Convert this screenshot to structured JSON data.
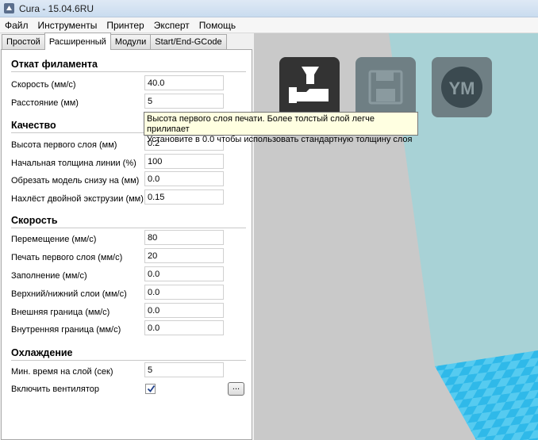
{
  "window": {
    "title": "Cura - 15.04.6RU"
  },
  "menu": [
    "Файл",
    "Инструменты",
    "Принтер",
    "Эксперт",
    "Помощь"
  ],
  "tabs": [
    "Простой",
    "Расширенный",
    "Модули",
    "Start/End-GCode"
  ],
  "active_tab": "Расширенный",
  "sections": {
    "retraction": {
      "title": "Откат филамента",
      "speed_label": "Скорость (мм/с)",
      "speed_value": "40.0",
      "distance_label": "Расстояние (мм)",
      "distance_value": "5"
    },
    "quality": {
      "title": "Качество",
      "first_layer_label": "Высота первого слоя (мм)",
      "first_layer_value": "0.2",
      "line_width_label": "Начальная толщина линии (%)",
      "line_width_value": "100",
      "cut_bottom_label": "Обрезать модель снизу на (мм)",
      "cut_bottom_value": "0.0",
      "dual_overlap_label": "Нахлёст двойной экструзии (мм)",
      "dual_overlap_value": "0.15"
    },
    "speed": {
      "title": "Скорость",
      "travel_label": "Перемещение (мм/с)",
      "travel_value": "80",
      "first_layer_label": "Печать первого слоя (мм/с)",
      "first_layer_value": "20",
      "infill_label": "Заполнение (мм/с)",
      "infill_value": "0.0",
      "top_bottom_label": "Верхний/нижний слои (мм/с)",
      "top_bottom_value": "0.0",
      "outer_shell_label": "Внешняя граница (мм/с)",
      "outer_shell_value": "0.0",
      "inner_shell_label": "Внутренняя граница (мм/с)",
      "inner_shell_value": "0.0"
    },
    "cooling": {
      "title": "Охлаждение",
      "min_layer_time_label": "Мин. время на слой (сек)",
      "min_layer_time_value": "5",
      "fan_label": "Включить вентилятор",
      "fan_enabled": true,
      "fan_settings_label": "..."
    }
  },
  "tooltip": {
    "line1": "Высота первого слоя печати. Более толстый слой легче прилипает",
    "line2": "Установите в 0.0 чтобы использовать стандартную толщину слоя"
  },
  "viewport_buttons": [
    {
      "icon": "load-model-icon",
      "state": "active"
    },
    {
      "icon": "save-icon",
      "state": "disabled"
    },
    {
      "icon": "youmagine-icon",
      "label": "YM",
      "state": "disabled"
    }
  ],
  "colors": {
    "viewport_bg": "#c9c9c9",
    "build_volume": "#a9d2d6",
    "build_plate": "#4cc6ed",
    "button_dark": "#333333",
    "button_disabled": "#6f7f84",
    "tooltip_bg": "#ffffe1"
  }
}
